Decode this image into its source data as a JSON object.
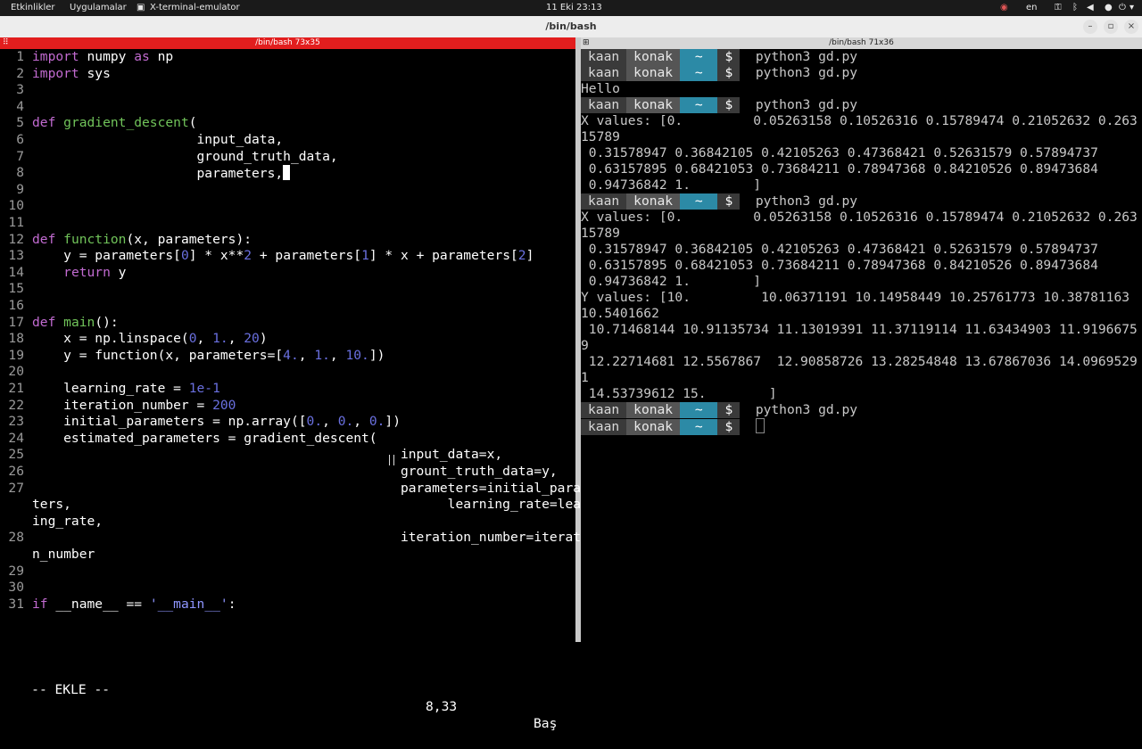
{
  "topbar": {
    "activities": "Etkinlikler",
    "apps": "Uygulamalar",
    "app_name": "X-terminal-emulator",
    "clock": "11 Eki  23:13",
    "lang": "en"
  },
  "window": {
    "title": "/bin/bash"
  },
  "left_pane": {
    "header": "/bin/bash 73x35",
    "lines": [
      {
        "n": "1",
        "t": "<span class='kw'>import</span> numpy <span class='kw'>as</span> np"
      },
      {
        "n": "2",
        "t": "<span class='kw'>import</span> sys"
      },
      {
        "n": "3",
        "t": ""
      },
      {
        "n": "4",
        "t": ""
      },
      {
        "n": "5",
        "t": "<span class='kw'>def</span> <span class='fn'>gradient_descent</span>("
      },
      {
        "n": "6",
        "t": "                     input_data,"
      },
      {
        "n": "7",
        "t": "                     ground_truth_data,"
      },
      {
        "n": "8",
        "t": "                     parameters,<span class='cursor'></span>"
      },
      {
        "n": "9",
        "t": ""
      },
      {
        "n": "10",
        "t": ""
      },
      {
        "n": "11",
        "t": ""
      },
      {
        "n": "12",
        "t": "<span class='kw'>def</span> <span class='fn'>function</span>(x, parameters):"
      },
      {
        "n": "13",
        "t": "    y = parameters[<span class='num'>0</span>] * x**<span class='num'>2</span> + parameters[<span class='num'>1</span>] * x + parameters[<span class='num'>2</span>]"
      },
      {
        "n": "14",
        "t": "    <span class='kw'>return</span> y"
      },
      {
        "n": "15",
        "t": ""
      },
      {
        "n": "16",
        "t": ""
      },
      {
        "n": "17",
        "t": "<span class='kw'>def</span> <span class='fn'>main</span>():"
      },
      {
        "n": "18",
        "t": "    x = np.linspace(<span class='num'>0</span>, <span class='num'>1.</span>, <span class='num'>20</span>)"
      },
      {
        "n": "19",
        "t": "    y = function(x, parameters=[<span class='num'>4.</span>, <span class='num'>1.</span>, <span class='num'>10.</span>])"
      },
      {
        "n": "20",
        "t": ""
      },
      {
        "n": "21",
        "t": "    learning_rate = <span class='num'>1e-1</span>"
      },
      {
        "n": "22",
        "t": "    iteration_number = <span class='num'>200</span>"
      },
      {
        "n": "23",
        "t": "    initial_parameters = np.array([<span class='num'>0.</span>, <span class='num'>0.</span>, <span class='num'>0.</span>])"
      },
      {
        "n": "24",
        "t": "    estimated_parameters = gradient_descent("
      },
      {
        "n": "25",
        "t": "                                               input_data=x,"
      },
      {
        "n": "26",
        "t": "                                               grount_truth_data=y,"
      },
      {
        "n": "27",
        "t": "                                               parameters=initial_parame"
      },
      {
        "n": "",
        "t": "ters,                                                learning_rate=learn"
      },
      {
        "n": "",
        "t": "ing_rate,"
      },
      {
        "n": "28",
        "t": "                                               iteration_number=iteratio"
      },
      {
        "n": "",
        "t": "n_number"
      },
      {
        "n": "29",
        "t": ""
      },
      {
        "n": "30",
        "t": ""
      },
      {
        "n": "31",
        "t": "<span class='kw'>if</span> __name__ == <span class='str'>'__main__'</span>:"
      }
    ],
    "status_mode": "-- EKLE --",
    "status_pos": "8,33",
    "status_scroll": "Baş"
  },
  "right_pane": {
    "header": "/bin/bash 71x36",
    "prompt_user": "kaan",
    "prompt_host": "konak",
    "prompt_dir": "~",
    "prompt_sym": "$",
    "lines": [
      {
        "type": "prompt",
        "cmd": "python3 gd.py"
      },
      {
        "type": "prompt",
        "cmd": "python3 gd.py"
      },
      {
        "type": "out",
        "text": "Hello"
      },
      {
        "type": "prompt",
        "cmd": "python3 gd.py"
      },
      {
        "type": "out",
        "text": "X values: [0.         0.05263158 0.10526316 0.15789474 0.21052632 0.263"
      },
      {
        "type": "out",
        "text": "15789"
      },
      {
        "type": "out",
        "text": " 0.31578947 0.36842105 0.42105263 0.47368421 0.52631579 0.57894737"
      },
      {
        "type": "out",
        "text": " 0.63157895 0.68421053 0.73684211 0.78947368 0.84210526 0.89473684"
      },
      {
        "type": "out",
        "text": " 0.94736842 1.        ]"
      },
      {
        "type": "prompt",
        "cmd": "python3 gd.py"
      },
      {
        "type": "out",
        "text": "X values: [0.         0.05263158 0.10526316 0.15789474 0.21052632 0.263"
      },
      {
        "type": "out",
        "text": "15789"
      },
      {
        "type": "out",
        "text": " 0.31578947 0.36842105 0.42105263 0.47368421 0.52631579 0.57894737"
      },
      {
        "type": "out",
        "text": " 0.63157895 0.68421053 0.73684211 0.78947368 0.84210526 0.89473684"
      },
      {
        "type": "out",
        "text": " 0.94736842 1.        ]"
      },
      {
        "type": "out",
        "text": "Y values: [10.         10.06371191 10.14958449 10.25761773 10.38781163"
      },
      {
        "type": "out",
        "text": "10.5401662"
      },
      {
        "type": "out",
        "text": " 10.71468144 10.91135734 11.13019391 11.37119114 11.63434903 11.9196675"
      },
      {
        "type": "out",
        "text": "9"
      },
      {
        "type": "out",
        "text": " 12.22714681 12.5567867  12.90858726 13.28254848 13.67867036 14.0969529"
      },
      {
        "type": "out",
        "text": "1"
      },
      {
        "type": "out",
        "text": " 14.53739612 15.        ]"
      },
      {
        "type": "prompt",
        "cmd": "python3 gd.py"
      },
      {
        "type": "prompt",
        "cmd": "",
        "cursor": true
      }
    ]
  }
}
